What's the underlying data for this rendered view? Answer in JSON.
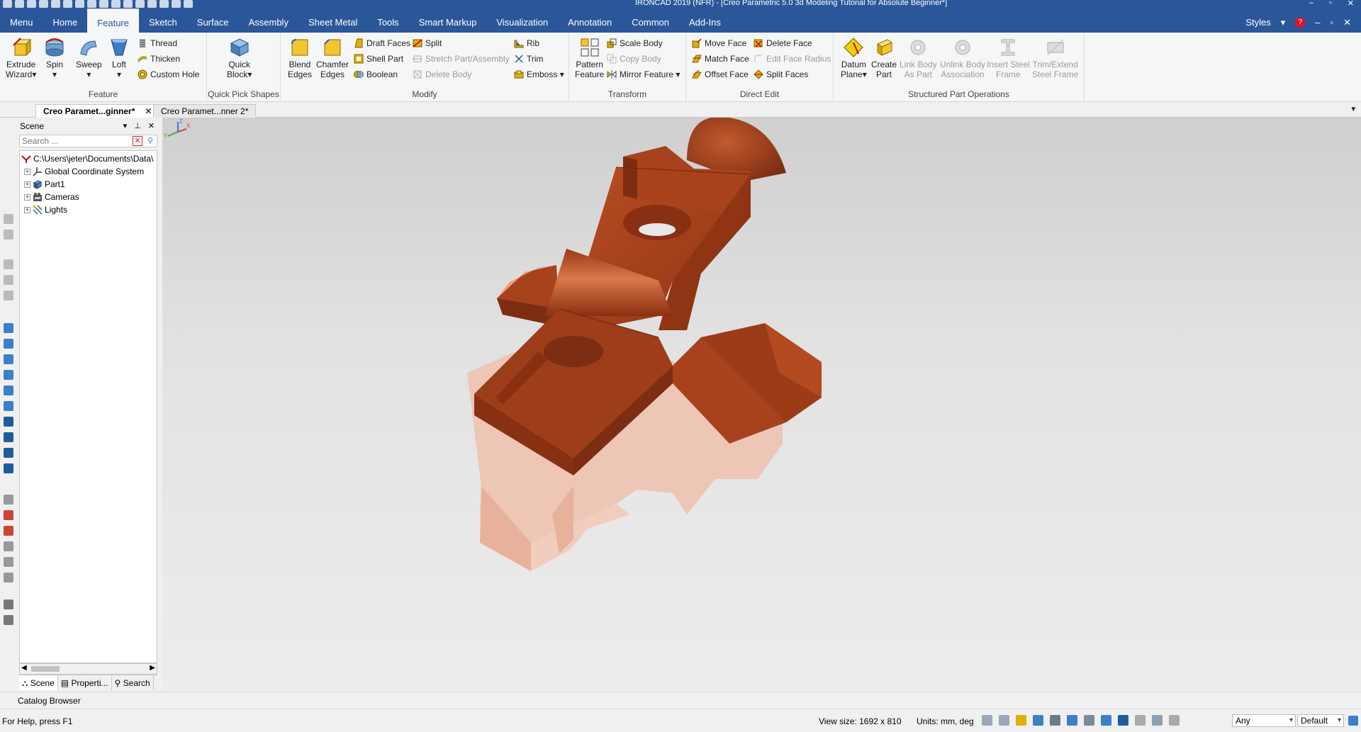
{
  "window": {
    "title": "IRONCAD 2019 (NFR) - [Creo Parametric 5.0 3d Modeling Tutorial for Absolute Beginner*]",
    "controls": [
      "–",
      "▫",
      "✕"
    ]
  },
  "menubar": {
    "tabs": [
      "Menu",
      "Home",
      "Feature",
      "Sketch",
      "Surface",
      "Assembly",
      "Sheet Metal",
      "Tools",
      "Smart Markup",
      "Visualization",
      "Annotation",
      "Common",
      "Add-Ins"
    ],
    "active_tab": "Feature",
    "styles_label": "Styles",
    "right_controls": [
      "?",
      "–",
      "▫",
      "✕"
    ]
  },
  "ribbon": {
    "feature": {
      "label": "Feature",
      "extrude": "Extrude\nWizard",
      "spin": "Spin",
      "sweep": "Sweep",
      "loft": "Loft",
      "thread": "Thread",
      "thicken": "Thicken",
      "custom_hole": "Custom Hole"
    },
    "quick_pick": {
      "label": "Quick Pick Shapes",
      "quick_block": "Quick\nBlock"
    },
    "modify": {
      "label": "Modify",
      "blend_edges": "Blend\nEdges",
      "chamfer_edges": "Chamfer\nEdges",
      "draft_faces": "Draft Faces",
      "shell_part": "Shell Part",
      "boolean": "Boolean",
      "split": "Split",
      "stretch": "Stretch Part/Assembly",
      "delete_body": "Delete Body",
      "rib": "Rib",
      "trim": "Trim",
      "emboss": "Emboss"
    },
    "transform": {
      "label": "Transform",
      "pattern": "Pattern\nFeature",
      "scale_body": "Scale Body",
      "copy_body": "Copy Body",
      "mirror_feature": "Mirror Feature"
    },
    "direct_edit": {
      "label": "Direct Edit",
      "move_face": "Move Face",
      "match_face": "Match Face",
      "offset_face": "Offset Face",
      "delete_face": "Delete Face",
      "edit_face_radius": "Edit Face Radius",
      "split_faces": "Split Faces"
    },
    "structured": {
      "label": "Structured Part Operations",
      "datum_plane": "Datum\nPlane",
      "create_part": "Create\nPart",
      "link_body": "Link Body\nAs Part",
      "unlink_body": "Unlink Body\nAssociation",
      "insert_steel": "Insert Steel\nFrame",
      "trim_extend": "Trim/Extend\nSteel Frame"
    }
  },
  "doc_tabs": [
    {
      "label": "Creo Paramet...ginner*",
      "active": true
    },
    {
      "label": "Creo Paramet...nner 2*",
      "active": false
    }
  ],
  "scene_panel": {
    "title": "Scene",
    "search_placeholder": "Search ...",
    "root": "C:\\Users\\jeter\\Documents\\Data\\",
    "items": [
      "Global Coordinate System",
      "Part1",
      "Cameras",
      "Lights"
    ],
    "bottom_tabs": [
      "Scene",
      "Properti...",
      "Search"
    ]
  },
  "catalog_browser": "Catalog Browser",
  "statusbar": {
    "help": "For Help, press F1",
    "view_size": "View size: 1692 x  810",
    "units": "Units: mm, deg",
    "filter": "Any",
    "style": "Default"
  },
  "triad": {
    "x": "X",
    "y": "Y",
    "z": "Z"
  },
  "colors": {
    "brand": "#2b579a",
    "part": "#a8421c",
    "part_dark": "#7d2d12",
    "part_light": "#e97a4f",
    "ghost": "#f1b59c"
  }
}
